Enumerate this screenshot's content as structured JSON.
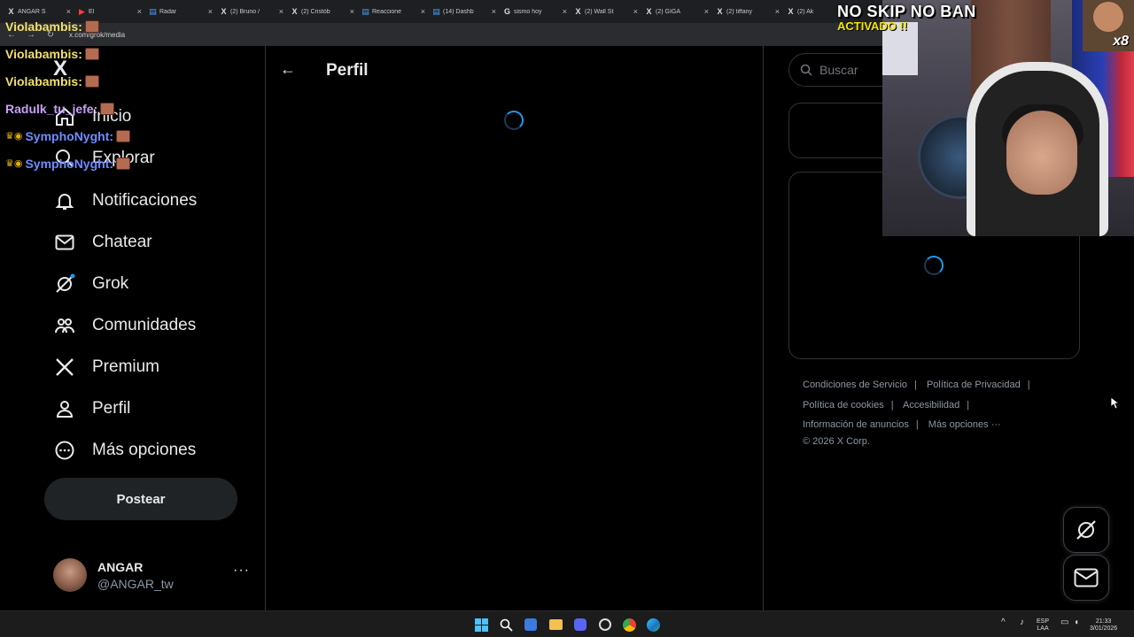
{
  "browser": {
    "url": "x.com/grok/media",
    "tabs": [
      {
        "icon": "x-icon",
        "title": "ANGAR S"
      },
      {
        "icon": "youtube-icon",
        "title": "El"
      },
      {
        "icon": "page-icon",
        "title": "Radar"
      },
      {
        "icon": "x-icon",
        "title": "(2) Bruno /"
      },
      {
        "icon": "x-icon",
        "title": "(2) Cristób"
      },
      {
        "icon": "page-icon",
        "title": "Reaccione"
      },
      {
        "icon": "page-icon",
        "title": "(14) Dashb"
      },
      {
        "icon": "google-icon",
        "title": "sismo hoy"
      },
      {
        "icon": "x-icon",
        "title": "(2) Wall St"
      },
      {
        "icon": "x-icon",
        "title": "(2) GIGA"
      },
      {
        "icon": "x-icon",
        "title": "(2) tiffany"
      },
      {
        "icon": "x-icon",
        "title": "(2) Ak"
      }
    ]
  },
  "sidebar": {
    "logo": "X",
    "items": [
      {
        "id": "inicio",
        "label": "Inicio",
        "icon": "home-icon"
      },
      {
        "id": "explorar",
        "label": "Explorar",
        "icon": "search-icon"
      },
      {
        "id": "notificaciones",
        "label": "Notificaciones",
        "icon": "bell-icon"
      },
      {
        "id": "chatear",
        "label": "Chatear",
        "icon": "mail-icon"
      },
      {
        "id": "grok",
        "label": "Grok",
        "icon": "grok-icon"
      },
      {
        "id": "comunidades",
        "label": "Comunidades",
        "icon": "people-icon"
      },
      {
        "id": "premium",
        "label": "Premium",
        "icon": "x-logo-icon"
      },
      {
        "id": "perfil",
        "label": "Perfil",
        "icon": "person-icon"
      },
      {
        "id": "mas",
        "label": "Más opciones",
        "icon": "more-circle-icon"
      }
    ],
    "post_label": "Postear",
    "account": {
      "name": "ANGAR",
      "handle": "@ANGAR_tw",
      "more": "···"
    }
  },
  "main": {
    "back": "←",
    "title": "Perfil"
  },
  "right": {
    "search_placeholder": "Buscar",
    "footer": {
      "links": [
        "Condiciones de Servicio",
        "Política de Privacidad",
        "Política de cookies",
        "Accesibilidad",
        "Información de anuncios",
        "Más opciones ···"
      ],
      "copyright": "© 2026 X Corp."
    }
  },
  "overlay": {
    "badge_line1": "NO SKIP NO BAN",
    "badge_line2": "ACTIVADO !!",
    "multiplier": "x8",
    "chat": [
      {
        "user": "Violabambis:",
        "color": "#f3e06a"
      },
      {
        "user": "Violabambis:",
        "color": "#f3e06a"
      },
      {
        "user": "Violabambis:",
        "color": "#f3e06a"
      },
      {
        "user": "Radulk_tu_jefe:",
        "color": "#c6a0f5"
      },
      {
        "user": "SymphoNyght:",
        "color": "#6f8cff",
        "crown": true
      },
      {
        "user": "SymphoNyght:",
        "color": "#6f8cff",
        "crown": true
      }
    ]
  },
  "taskbar": {
    "lang": "ESP",
    "lang2": "LAA",
    "time": "21:33",
    "date": "3/01/2026"
  }
}
